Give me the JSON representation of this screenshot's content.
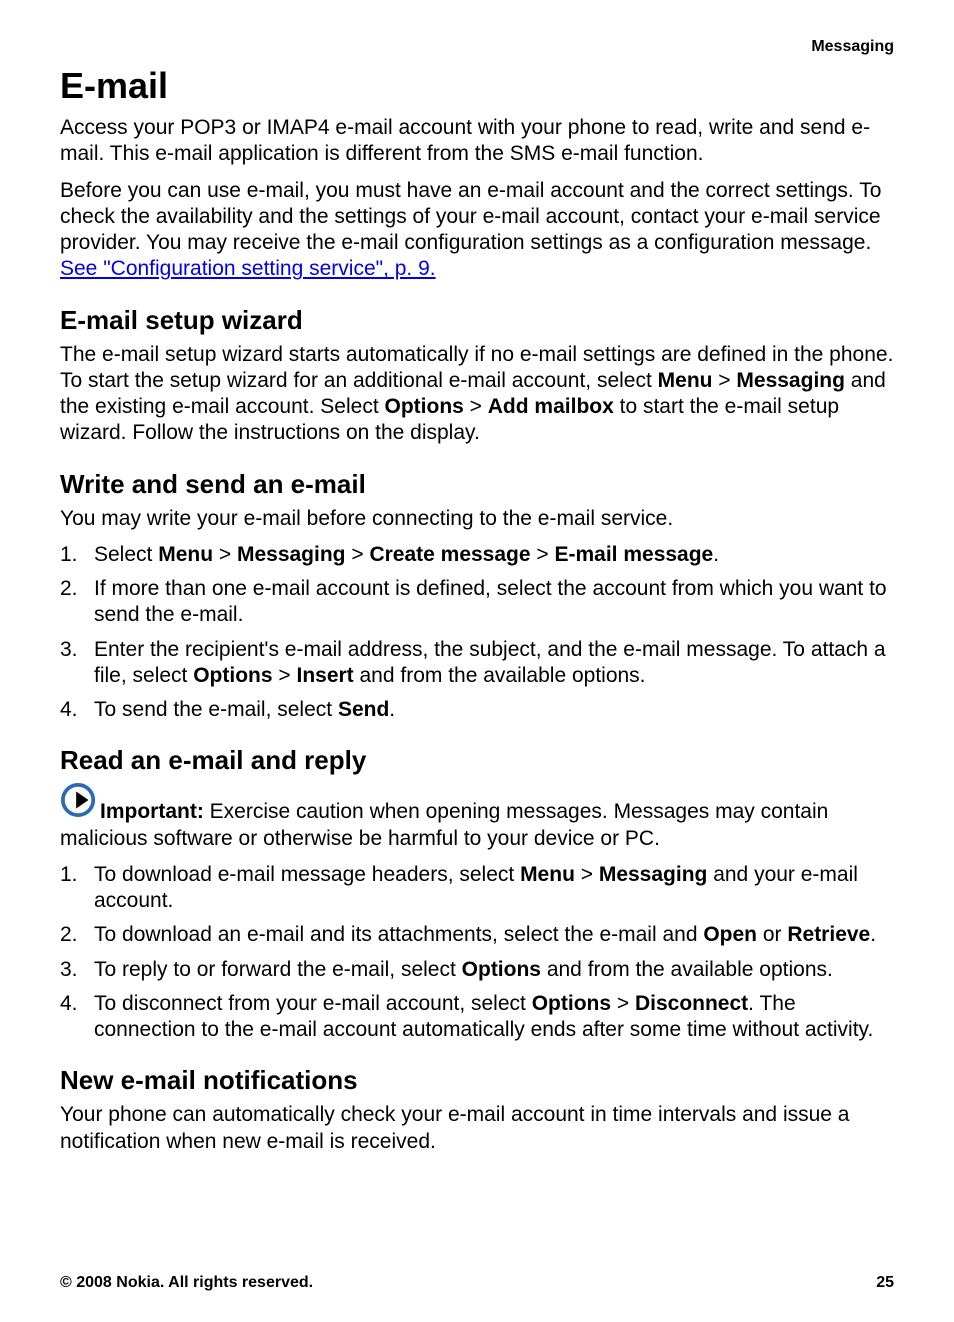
{
  "header": {
    "section_label": "Messaging"
  },
  "title": "E-mail",
  "intro_p1": "Access your POP3 or IMAP4 e-mail account with your phone to read, write and send e-mail. This e-mail application is different from the SMS e-mail function.",
  "intro_p2_before_link": "Before you can use e-mail, you must have an e-mail account and the correct settings. To check the availability and the settings of your e-mail account, contact your e-mail service provider. You may receive the e-mail configuration settings as a configuration message. ",
  "intro_link": "See \"Configuration setting service\", p. 9.",
  "setup": {
    "heading": "E-mail setup wizard",
    "p_part1": "The e-mail setup wizard starts automatically if no e-mail settings are defined in the phone. To start the setup wizard for an additional e-mail account, select ",
    "menu": "Menu",
    "gt1": " > ",
    "messaging": "Messaging",
    "p_part2": " and the existing e-mail account. Select ",
    "options": "Options",
    "gt2": " > ",
    "add_mailbox": "Add mailbox",
    "p_part3": " to start the e-mail setup wizard. Follow the instructions on the display."
  },
  "write": {
    "heading": "Write and send an e-mail",
    "intro": "You may write your e-mail before connecting to the e-mail service.",
    "step1": {
      "num": "1.",
      "a": "Select ",
      "menu": "Menu",
      "gt1": " > ",
      "messaging": "Messaging",
      "gt2": " > ",
      "create": "Create message",
      "gt3": " > ",
      "email_msg": "E-mail message",
      "b": "."
    },
    "step2": {
      "num": "2.",
      "text": "If more than one e-mail account is defined, select the account from which you want to send the e-mail."
    },
    "step3": {
      "num": "3.",
      "a": "Enter the recipient's e-mail address, the subject, and the e-mail message. To attach a file, select ",
      "options": "Options",
      "gt": " > ",
      "insert": "Insert",
      "b": " and from the available options."
    },
    "step4": {
      "num": "4.",
      "a": "To send the e-mail, select ",
      "send": "Send",
      "b": "."
    }
  },
  "read": {
    "heading": "Read an e-mail and reply",
    "important_label": "Important:",
    "important_text": " Exercise caution when opening messages. Messages may contain malicious software or otherwise be harmful to your device or PC.",
    "step1": {
      "num": "1.",
      "a": "To download e-mail message headers, select ",
      "menu": "Menu",
      "gt": " > ",
      "messaging": "Messaging",
      "b": " and your e-mail account."
    },
    "step2": {
      "num": "2.",
      "a": "To download an e-mail and its attachments, select the e-mail and ",
      "open": "Open",
      "or": " or ",
      "retrieve": "Retrieve",
      "b": "."
    },
    "step3": {
      "num": "3.",
      "a": "To reply to or forward the e-mail, select ",
      "options": "Options",
      "b": " and from the available options."
    },
    "step4": {
      "num": "4.",
      "a": "To disconnect from your e-mail account, select ",
      "options": "Options",
      "gt": " > ",
      "disconnect": "Disconnect",
      "b": ". The connection to the e-mail account automatically ends after some time without activity."
    }
  },
  "notifications": {
    "heading": "New e-mail notifications",
    "text": "Your phone can automatically check your e-mail account in time intervals and issue a notification when new e-mail is received."
  },
  "footer": {
    "copyright": "© 2008 Nokia. All rights reserved.",
    "page": "25"
  }
}
